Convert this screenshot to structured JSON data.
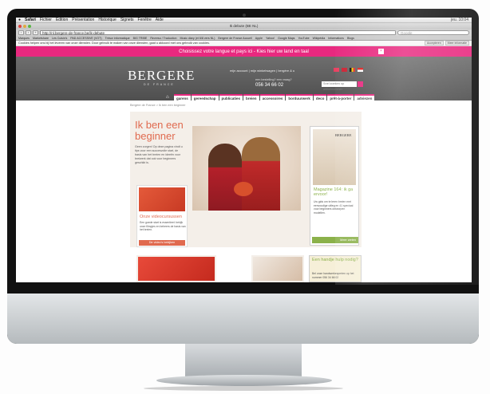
{
  "menubar": {
    "apple": "",
    "app": "Safari",
    "items": [
      "Fichier",
      "Edition",
      "Présentation",
      "Historique",
      "Signets",
      "Fenêtre",
      "Aide"
    ],
    "clock": "jeu. 10:04"
  },
  "browser": {
    "window_title": "Ik debute (BE NL)",
    "url": "http://nl.bergere-de-france.be/ik-debute",
    "search_placeholder": "Google",
    "bookmarks": [
      "Marques",
      "Marketshare",
      "Les Cuisin’s",
      "PAD ACCESSIVE (VOT)",
      "Trésor informatique",
      "BIG TRIBE",
      "Reverso / Traduction",
      "Music diary (et 6/8 vers NL)",
      "Bergere de France Accueil",
      "Apple",
      "Yahoo!",
      "Google Maps",
      "YouTube",
      "Wikipédia",
      "Informations",
      "Blogs"
    ],
    "cookie_text": "Cookies helpen ons bij het leveren van onze diensten. Door gebruik te maken van onze diensten, gaat u akkoord met ons gebruik van cookies.",
    "cookie_btns": [
      "Accepteren",
      "Meer informatie"
    ]
  },
  "site": {
    "lang_banner": "Choisissez votre langue et pays ici - Kies hier uw land en taal",
    "close": "×",
    "logo": "BERGERE",
    "logo_sub": "DE FRANCE",
    "account": "mijn account | mijn winkelwagen | bergère & u",
    "phone_label": "een bestelling? een vraag?",
    "phone": "056 34 66 02",
    "search_placeholder": "Snel zoeken op artikelnummer",
    "nav": [
      "garens",
      "gereedschap",
      "publicaties",
      "breien",
      "accessoires",
      "borduurwerk",
      "deco",
      "prêt-à-porter",
      "adviezen"
    ],
    "breadcrumb": "Bergère de France > Ik ben een beginner",
    "hero_title_1": "Ik ben een",
    "hero_title_2": "beginner",
    "hero_text": "Geen zorgen! Op deze pagina vindt u tips voor een succesvolle start, de basis van het breien en ideeën voor breiwerk dat ook voor beginners geschikt is.",
    "magazine_logo": "BERGERE",
    "magazine_title": "Magazine 164: ik ga ervoor!",
    "magazine_text": "Uw gids om te leren breien met eenvoudige uitleg en 41 speciaal voor beginners ontworpen modellen.",
    "magazine_btn": "Meer weten",
    "video_title": "Onze videocursussen",
    "video_text": "Een goede start is essentieel: bekijk onze filmpjes en beheers de basis van het breien.",
    "video_btn": "De video's bekijken",
    "help_title": "Een handje hulp nodig?",
    "help_text": "Bel onze handwerkexperten op het nummer 056 34 66 02"
  }
}
